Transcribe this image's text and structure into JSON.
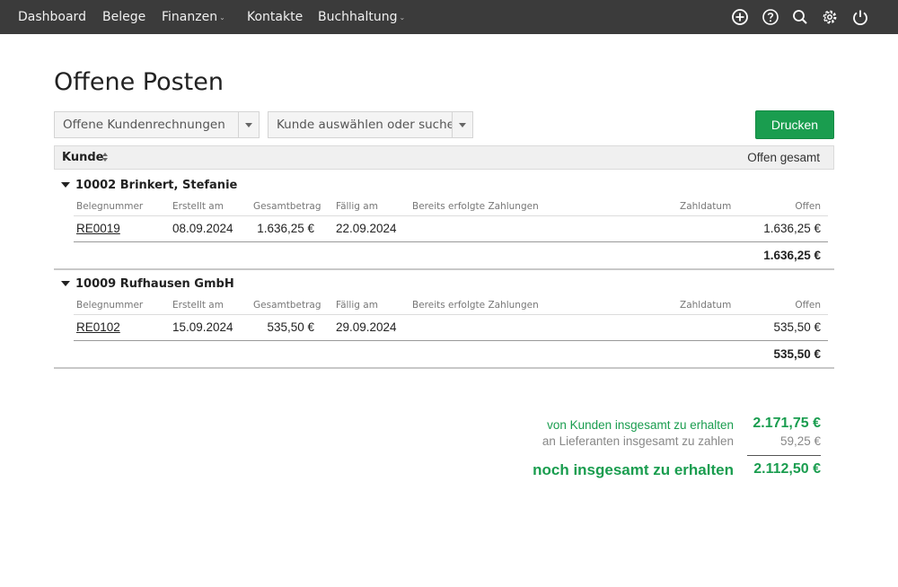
{
  "nav": {
    "items": [
      {
        "label": "Dashboard",
        "has_menu": false
      },
      {
        "label": "Belege",
        "has_menu": false
      },
      {
        "label": "Finanzen",
        "has_menu": true
      },
      {
        "label": "Kontakte",
        "has_menu": false
      },
      {
        "label": "Buchhaltung",
        "has_menu": true
      }
    ],
    "icons": [
      "plus-circle-icon",
      "help-icon",
      "search-icon",
      "settings-icon",
      "power-icon"
    ]
  },
  "page": {
    "title": "Offene Posten"
  },
  "filters": {
    "type_select": "Offene Kundenrechnungen",
    "customer_select": "Kunde auswählen oder suchen",
    "print_button": "Drucken"
  },
  "table": {
    "col_customer": "Kunde",
    "col_open_total": "Offen gesamt",
    "columns": {
      "number": "Belegnummer",
      "created": "Erstellt am",
      "total": "Gesamtbetrag",
      "due": "Fällig am",
      "payments": "Bereits erfolgte Zahlungen",
      "paydate": "Zahldatum",
      "open": "Offen"
    },
    "groups": [
      {
        "name": "10002 Brinkert, Stefanie",
        "rows": [
          {
            "number": "RE0019",
            "created": "08.09.2024",
            "total": "1.636,25 €",
            "due": "22.09.2024",
            "payments": "",
            "paydate": "",
            "open": "1.636,25 €"
          }
        ],
        "subtotal": "1.636,25 €"
      },
      {
        "name": "10009 Rufhausen GmbH",
        "rows": [
          {
            "number": "RE0102",
            "created": "15.09.2024",
            "total": "535,50 €",
            "due": "29.09.2024",
            "payments": "",
            "paydate": "",
            "open": "535,50 €"
          }
        ],
        "subtotal": "535,50 €"
      }
    ]
  },
  "summary": {
    "receive_label": "von Kunden insgesamt zu erhalten",
    "receive_value": "2.171,75 €",
    "pay_label": "an Lieferanten insgesamt zu zahlen",
    "pay_value": "59,25 €",
    "total_label": "noch insgesamt zu erhalten",
    "total_value": "2.112,50 €"
  },
  "colors": {
    "nav_bg": "#3b3b3b",
    "accent_green": "#1a9d4f"
  }
}
